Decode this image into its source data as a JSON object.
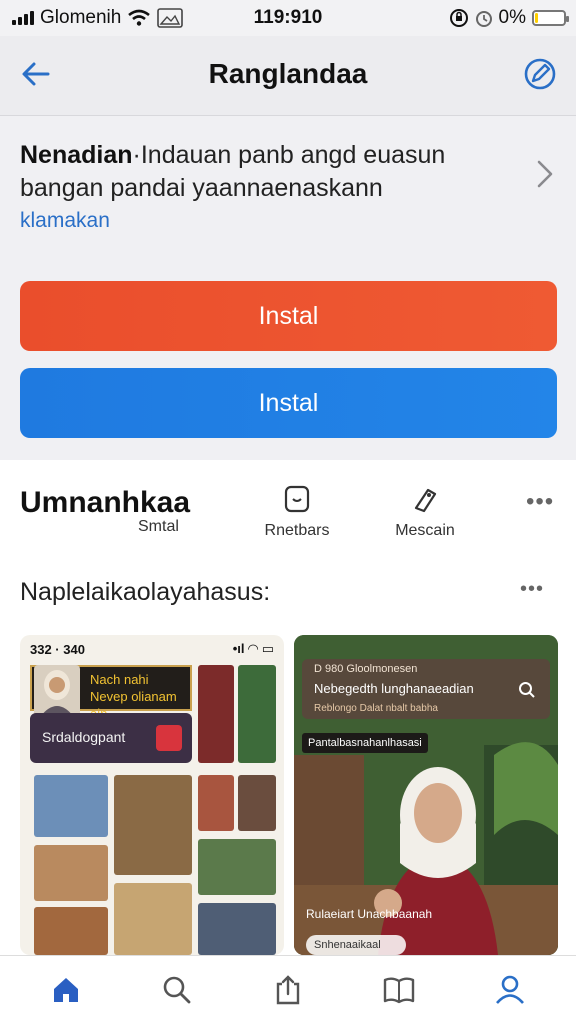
{
  "status_bar": {
    "carrier": "Glomenih",
    "time": "119:910",
    "battery_label": "0%",
    "battery_level": 0.1,
    "icons": [
      "signal-icon",
      "wifi-icon",
      "image-icon",
      "lock-rotation-icon",
      "alarm-icon",
      "battery-icon"
    ]
  },
  "nav": {
    "title": "Ranglandaa",
    "back_icon": "back-arrow-icon",
    "edit_icon": "edit-icon"
  },
  "app": {
    "name": "Nenadian",
    "desc_line1_rest": "·Indauan panb angd euasun",
    "desc_line2": "bangan pandai yaannaenaskann",
    "link": "klamakan"
  },
  "buttons": {
    "install_primary": "Instal",
    "install_secondary": "Instal",
    "primary_color": "#ea4e2c",
    "secondary_color": "#1f7ae0"
  },
  "section": {
    "title": "Umnanhkaa",
    "subtitle": "Smtal",
    "actions": [
      {
        "label": "Rnetbars",
        "icon": "bookmark-icon"
      },
      {
        "label": "Mescain",
        "icon": "share-tag-icon"
      }
    ],
    "more_icon": "more-dots-icon"
  },
  "screenshots": {
    "title": "Naplelaikaolayahasus:",
    "shot1": {
      "status_time": "332 · 340",
      "banner_line1": "Nach nahi",
      "banner_line2": "Nevep olianam ain",
      "card_label": "Srdaldogpant"
    },
    "shot2": {
      "header_top": "D 980 Gloolmonesen",
      "header_title": "Nebegedth lunghanaeadian",
      "header_sub": "Reblongo Dalat nbalt babha",
      "tag": "Pantalbasnahanlhasasi",
      "caption": "Rulaeiart Unachbaanah",
      "pill": "Snhenaaikaal"
    }
  },
  "tab_bar": {
    "items": [
      "home-icon",
      "search-icon",
      "share-icon",
      "book-icon",
      "profile-icon"
    ],
    "active_color": "#2a6fc7"
  }
}
